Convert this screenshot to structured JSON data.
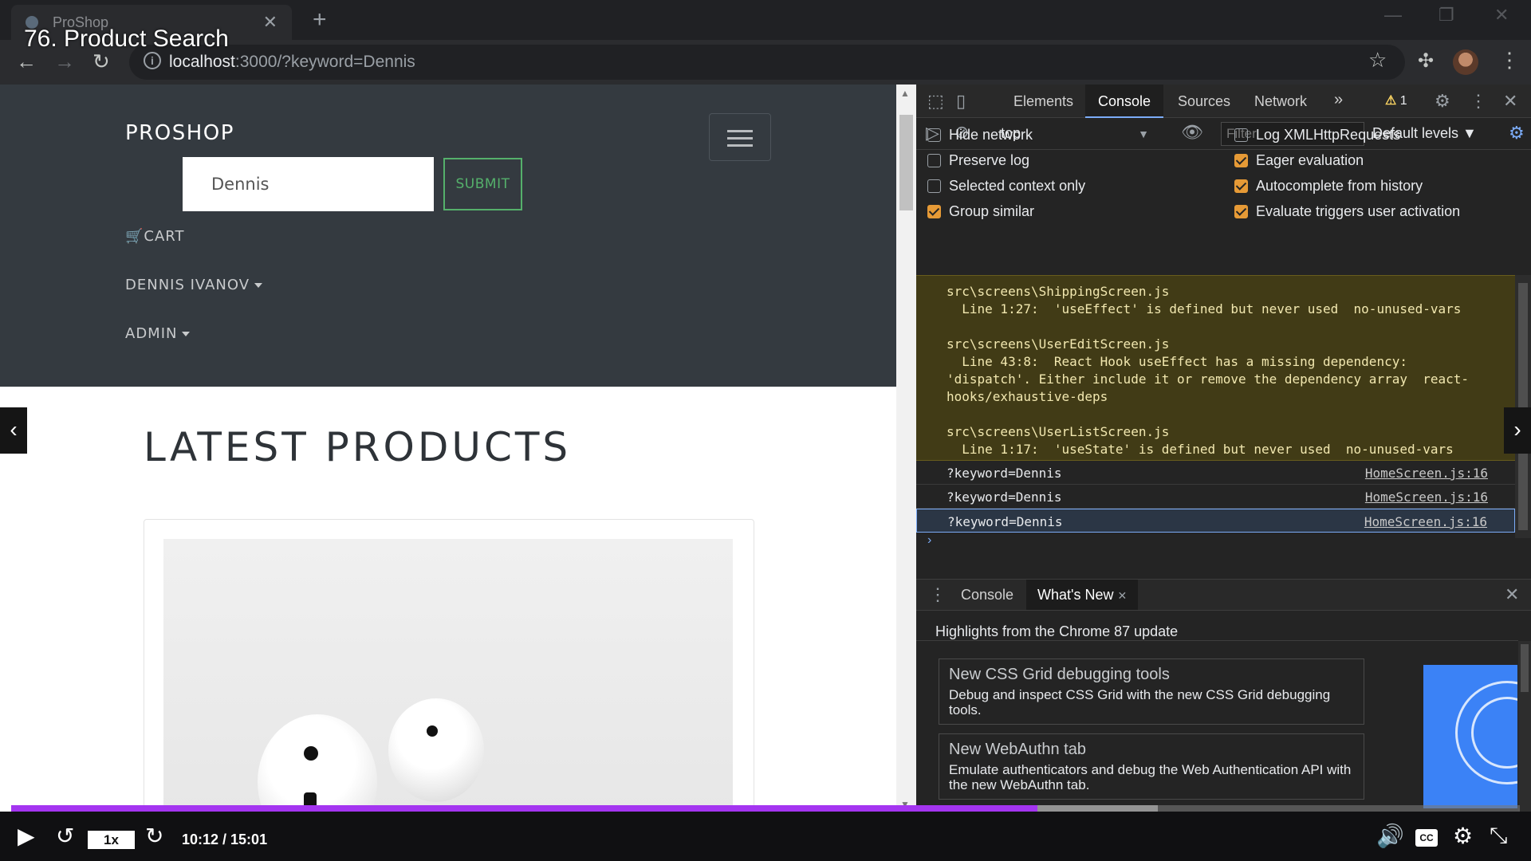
{
  "browser": {
    "tab_title": "ProShop",
    "tab_close": "✕",
    "new_tab": "+",
    "window_controls": [
      "—",
      "❐",
      "✕"
    ],
    "url_host": "localhost",
    "url_rest": ":3000/?keyword=Dennis",
    "icons": [
      "back-icon",
      "forward-icon",
      "reload-icon",
      "info-icon",
      "star-icon",
      "extensions-icon",
      "menu-icon"
    ]
  },
  "video": {
    "title": "76. Product Search",
    "speed": "1x",
    "time": "10:12 / 15:01",
    "progress": 0.68,
    "buffered": 0.76,
    "prev_arrow": "‹",
    "next_arrow": "›",
    "cc_label": "CC"
  },
  "site": {
    "brand": "PROSHOP",
    "search_value": "Dennis",
    "submit_label": "SUBMIT",
    "cart_label": "CART",
    "user_label": "DENNIS IVANOV",
    "admin_label": "ADMIN",
    "heading": "LATEST PRODUCTS"
  },
  "devtools": {
    "tabs": [
      "Elements",
      "Console",
      "Sources",
      "Network"
    ],
    "active_tab": "Console",
    "more_tabs": "»",
    "warning_count": "1",
    "context": "top",
    "filter_placeholder": "Filter",
    "levels": "Default levels ▼",
    "options_left": [
      {
        "label": "Hide network",
        "checked": false
      },
      {
        "label": "Preserve log",
        "checked": false
      },
      {
        "label": "Selected context only",
        "checked": false
      },
      {
        "label": "Group similar",
        "checked": true
      }
    ],
    "options_right": [
      {
        "label": "Log XMLHttpRequests",
        "checked": false
      },
      {
        "label": "Eager evaluation",
        "checked": true
      },
      {
        "label": "Autocomplete from history",
        "checked": true
      },
      {
        "label": "Evaluate triggers user activation",
        "checked": true
      }
    ],
    "warning_text": "src\\screens\\ShippingScreen.js\n  Line 1:27:  'useEffect' is defined but never used  no-unused-vars\n\nsrc\\screens\\UserEditScreen.js\n  Line 43:8:  React Hook useEffect has a missing dependency:\n'dispatch'. Either include it or remove the dependency array  react-\nhooks/exhaustive-deps\n\nsrc\\screens\\UserListScreen.js\n  Line 1:17:  'useState' is defined but never used  no-unused-vars",
    "logs": [
      {
        "msg": "?keyword=Dennis",
        "src": "HomeScreen.js:16"
      },
      {
        "msg": "?keyword=Dennis",
        "src": "HomeScreen.js:16"
      },
      {
        "msg": "?keyword=Dennis",
        "src": "HomeScreen.js:16"
      }
    ],
    "prompt": "›",
    "drawer": {
      "tabs": [
        "Console",
        "What's New"
      ],
      "close": "✕",
      "highlights": "Highlights from the Chrome 87 update",
      "cards": [
        {
          "title": "New CSS Grid debugging tools",
          "desc": "Debug and inspect CSS Grid with the new CSS Grid debugging tools."
        },
        {
          "title": "New WebAuthn tab",
          "desc": "Emulate authenticators and debug the Web Authentication API with the new WebAuthn tab."
        }
      ]
    }
  }
}
